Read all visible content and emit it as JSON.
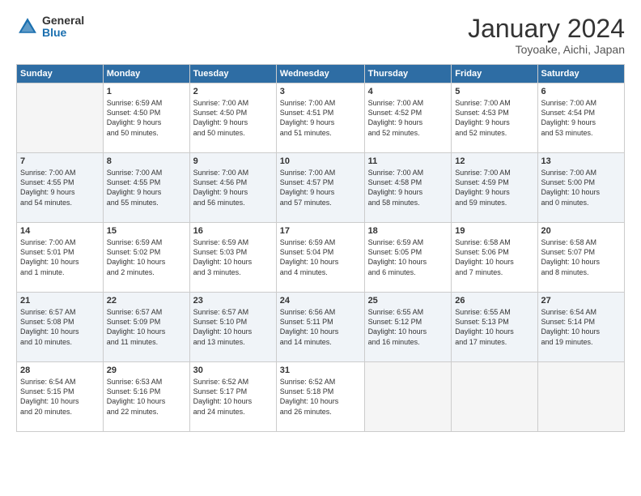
{
  "logo": {
    "general": "General",
    "blue": "Blue"
  },
  "header": {
    "month": "January 2024",
    "location": "Toyoake, Aichi, Japan"
  },
  "days_of_week": [
    "Sunday",
    "Monday",
    "Tuesday",
    "Wednesday",
    "Thursday",
    "Friday",
    "Saturday"
  ],
  "weeks": [
    [
      {
        "day": "",
        "info": ""
      },
      {
        "day": "1",
        "info": "Sunrise: 6:59 AM\nSunset: 4:50 PM\nDaylight: 9 hours\nand 50 minutes."
      },
      {
        "day": "2",
        "info": "Sunrise: 7:00 AM\nSunset: 4:50 PM\nDaylight: 9 hours\nand 50 minutes."
      },
      {
        "day": "3",
        "info": "Sunrise: 7:00 AM\nSunset: 4:51 PM\nDaylight: 9 hours\nand 51 minutes."
      },
      {
        "day": "4",
        "info": "Sunrise: 7:00 AM\nSunset: 4:52 PM\nDaylight: 9 hours\nand 52 minutes."
      },
      {
        "day": "5",
        "info": "Sunrise: 7:00 AM\nSunset: 4:53 PM\nDaylight: 9 hours\nand 52 minutes."
      },
      {
        "day": "6",
        "info": "Sunrise: 7:00 AM\nSunset: 4:54 PM\nDaylight: 9 hours\nand 53 minutes."
      }
    ],
    [
      {
        "day": "7",
        "info": "Sunrise: 7:00 AM\nSunset: 4:55 PM\nDaylight: 9 hours\nand 54 minutes."
      },
      {
        "day": "8",
        "info": "Sunrise: 7:00 AM\nSunset: 4:55 PM\nDaylight: 9 hours\nand 55 minutes."
      },
      {
        "day": "9",
        "info": "Sunrise: 7:00 AM\nSunset: 4:56 PM\nDaylight: 9 hours\nand 56 minutes."
      },
      {
        "day": "10",
        "info": "Sunrise: 7:00 AM\nSunset: 4:57 PM\nDaylight: 9 hours\nand 57 minutes."
      },
      {
        "day": "11",
        "info": "Sunrise: 7:00 AM\nSunset: 4:58 PM\nDaylight: 9 hours\nand 58 minutes."
      },
      {
        "day": "12",
        "info": "Sunrise: 7:00 AM\nSunset: 4:59 PM\nDaylight: 9 hours\nand 59 minutes."
      },
      {
        "day": "13",
        "info": "Sunrise: 7:00 AM\nSunset: 5:00 PM\nDaylight: 10 hours\nand 0 minutes."
      }
    ],
    [
      {
        "day": "14",
        "info": "Sunrise: 7:00 AM\nSunset: 5:01 PM\nDaylight: 10 hours\nand 1 minute."
      },
      {
        "day": "15",
        "info": "Sunrise: 6:59 AM\nSunset: 5:02 PM\nDaylight: 10 hours\nand 2 minutes."
      },
      {
        "day": "16",
        "info": "Sunrise: 6:59 AM\nSunset: 5:03 PM\nDaylight: 10 hours\nand 3 minutes."
      },
      {
        "day": "17",
        "info": "Sunrise: 6:59 AM\nSunset: 5:04 PM\nDaylight: 10 hours\nand 4 minutes."
      },
      {
        "day": "18",
        "info": "Sunrise: 6:59 AM\nSunset: 5:05 PM\nDaylight: 10 hours\nand 6 minutes."
      },
      {
        "day": "19",
        "info": "Sunrise: 6:58 AM\nSunset: 5:06 PM\nDaylight: 10 hours\nand 7 minutes."
      },
      {
        "day": "20",
        "info": "Sunrise: 6:58 AM\nSunset: 5:07 PM\nDaylight: 10 hours\nand 8 minutes."
      }
    ],
    [
      {
        "day": "21",
        "info": "Sunrise: 6:57 AM\nSunset: 5:08 PM\nDaylight: 10 hours\nand 10 minutes."
      },
      {
        "day": "22",
        "info": "Sunrise: 6:57 AM\nSunset: 5:09 PM\nDaylight: 10 hours\nand 11 minutes."
      },
      {
        "day": "23",
        "info": "Sunrise: 6:57 AM\nSunset: 5:10 PM\nDaylight: 10 hours\nand 13 minutes."
      },
      {
        "day": "24",
        "info": "Sunrise: 6:56 AM\nSunset: 5:11 PM\nDaylight: 10 hours\nand 14 minutes."
      },
      {
        "day": "25",
        "info": "Sunrise: 6:55 AM\nSunset: 5:12 PM\nDaylight: 10 hours\nand 16 minutes."
      },
      {
        "day": "26",
        "info": "Sunrise: 6:55 AM\nSunset: 5:13 PM\nDaylight: 10 hours\nand 17 minutes."
      },
      {
        "day": "27",
        "info": "Sunrise: 6:54 AM\nSunset: 5:14 PM\nDaylight: 10 hours\nand 19 minutes."
      }
    ],
    [
      {
        "day": "28",
        "info": "Sunrise: 6:54 AM\nSunset: 5:15 PM\nDaylight: 10 hours\nand 20 minutes."
      },
      {
        "day": "29",
        "info": "Sunrise: 6:53 AM\nSunset: 5:16 PM\nDaylight: 10 hours\nand 22 minutes."
      },
      {
        "day": "30",
        "info": "Sunrise: 6:52 AM\nSunset: 5:17 PM\nDaylight: 10 hours\nand 24 minutes."
      },
      {
        "day": "31",
        "info": "Sunrise: 6:52 AM\nSunset: 5:18 PM\nDaylight: 10 hours\nand 26 minutes."
      },
      {
        "day": "",
        "info": ""
      },
      {
        "day": "",
        "info": ""
      },
      {
        "day": "",
        "info": ""
      }
    ]
  ]
}
